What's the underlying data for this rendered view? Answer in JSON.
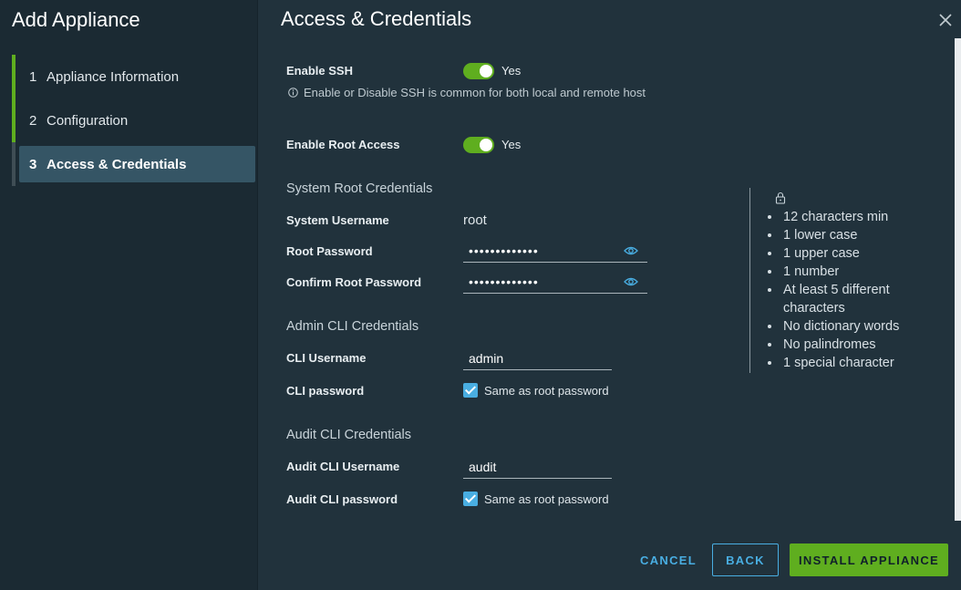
{
  "dialog": {
    "title": "Add Appliance",
    "colors": {
      "accent_green": "#5fae1f",
      "accent_blue": "#49aee2",
      "active_step_bg": "#355565"
    }
  },
  "steps": [
    {
      "number": "1",
      "label": "Appliance Information",
      "state": "complete"
    },
    {
      "number": "2",
      "label": "Configuration",
      "state": "complete"
    },
    {
      "number": "3",
      "label": "Access & Credentials",
      "state": "active"
    }
  ],
  "page": {
    "heading": "Access & Credentials",
    "close_icon": "close-icon"
  },
  "ssh": {
    "label": "Enable SSH",
    "value": "Yes",
    "enabled": true,
    "info": "Enable or Disable SSH is common for both local and remote host"
  },
  "root_access": {
    "label": "Enable Root Access",
    "value": "Yes",
    "enabled": true
  },
  "system_root": {
    "section_title": "System Root Credentials",
    "username_label": "System Username",
    "username_value": "root",
    "password_label": "Root Password",
    "password_value": "•••••••••••••",
    "confirm_label": "Confirm Root Password",
    "confirm_value": "•••••••••••••"
  },
  "admin_cli": {
    "section_title": "Admin CLI Credentials",
    "username_label": "CLI Username",
    "username_value": "admin",
    "password_label": "CLI password",
    "same_as_root": "Same as root password"
  },
  "audit_cli": {
    "section_title": "Audit CLI Credentials",
    "username_label": "Audit CLI Username",
    "username_value": "audit",
    "password_label": "Audit CLI password",
    "same_as_root": "Same as root password"
  },
  "password_rules": [
    "12 characters min",
    "1 lower case",
    "1 upper case",
    "1 number",
    "At least 5 different characters",
    "No dictionary words",
    "No palindromes",
    "1 special character"
  ],
  "footer": {
    "cancel": "CANCEL",
    "back": "BACK",
    "install": "INSTALL APPLIANCE"
  }
}
